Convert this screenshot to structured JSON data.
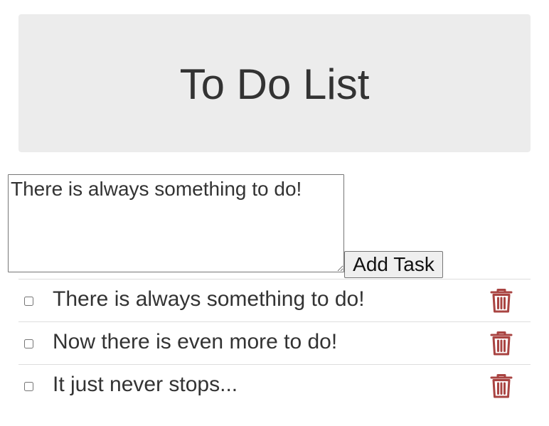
{
  "header": {
    "title": "To Do List"
  },
  "input": {
    "value": "There is always something to do!"
  },
  "add_button": {
    "label": "Add Task"
  },
  "tasks": [
    {
      "text": "There is always something to do!",
      "checked": false
    },
    {
      "text": "Now there is even more to do!",
      "checked": false
    },
    {
      "text": "It just never stops...",
      "checked": false
    }
  ],
  "colors": {
    "header_bg": "#ececec",
    "text": "#333333",
    "trash_icon": "#a94442",
    "divider": "#dddddd"
  },
  "icons": {
    "delete": "trash-icon"
  }
}
